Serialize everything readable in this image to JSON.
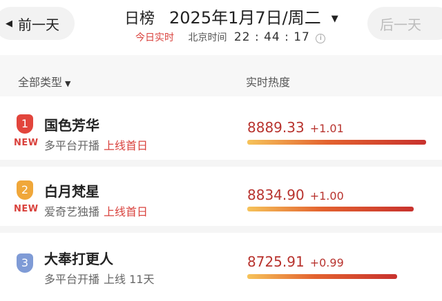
{
  "header": {
    "prev_label": "前一天",
    "next_label": "后一天",
    "title": "日榜",
    "date": "2025年1月7日/周二",
    "realtime_label": "今日实时",
    "beijing_label": "北京时间",
    "time": "22 : 44 : 17",
    "info_icon": "ⓘ"
  },
  "columns": {
    "type_filter": "全部类型",
    "heat": "实时热度"
  },
  "rows": [
    {
      "rank": "1",
      "name": "国色芳华",
      "new": "NEW",
      "platform": "多平台开播",
      "status": "上线首日",
      "score": "8889.33",
      "delta": "+1.01",
      "heat_fraction": 0.99,
      "badge_color": "#e2453c"
    },
    {
      "rank": "2",
      "name": "白月梵星",
      "new": "NEW",
      "platform": "爱奇艺独播",
      "status": "上线首日",
      "score": "8834.90",
      "delta": "+1.00",
      "heat_fraction": 0.92,
      "badge_color": "#f0a73a"
    },
    {
      "rank": "3",
      "name": "大奉打更人",
      "new": "",
      "platform": "多平台开播",
      "status": "上线 11天",
      "score": "8725.91",
      "delta": "+0.99",
      "heat_fraction": 0.83,
      "badge_color": "#7f9bd6"
    }
  ]
}
